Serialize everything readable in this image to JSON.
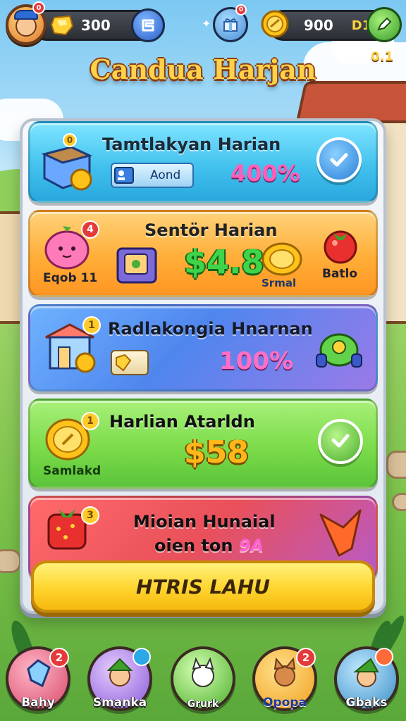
{
  "topbar": {
    "avatar_badge": "0",
    "currency1_value": "300",
    "currency2_value": "900",
    "currency2_tag": "D1",
    "gift_badge": "0"
  },
  "title": "Candua Harjan",
  "corner_text": "0.1",
  "cards": [
    {
      "title": "Tamtlakyan Harian",
      "tag": "Aond",
      "value": "400%",
      "badge": "0",
      "color": "#4cc9ee"
    },
    {
      "title": "Sentör Harian",
      "left_label": "Eqob 11",
      "value": "$4.8",
      "coin_label": "Srmal",
      "right_label": "Batlo",
      "badge": "4",
      "color": "#ffb03a"
    },
    {
      "title": "Radlakongia Hnarnan",
      "value": "100%",
      "badge": "1",
      "color": "#5a8df0"
    },
    {
      "title": "Harlian Atarldn",
      "value": "$58",
      "left_label": "Samlakd",
      "badge": "1",
      "color": "#7cdc4a"
    },
    {
      "title_line1": "Mioian Hunaial",
      "title_line2_prefix": "oien ton",
      "title_line2_suffix": "9A",
      "badge": "3",
      "color": "#e9505a"
    }
  ],
  "claim_button": "HTRIS LAHU",
  "nav": [
    {
      "label": "Bahy",
      "badge": "2",
      "color": "#e86a86"
    },
    {
      "label": "Smanka",
      "badge": "",
      "color": "#b08ae6"
    },
    {
      "label": "Grurk",
      "badge": "",
      "color": "#7ed858"
    },
    {
      "label": "Opopa",
      "badge": "2",
      "color": "#f6b63a"
    },
    {
      "label": "Gbaks",
      "badge": "",
      "color": "#68b6d6"
    }
  ]
}
